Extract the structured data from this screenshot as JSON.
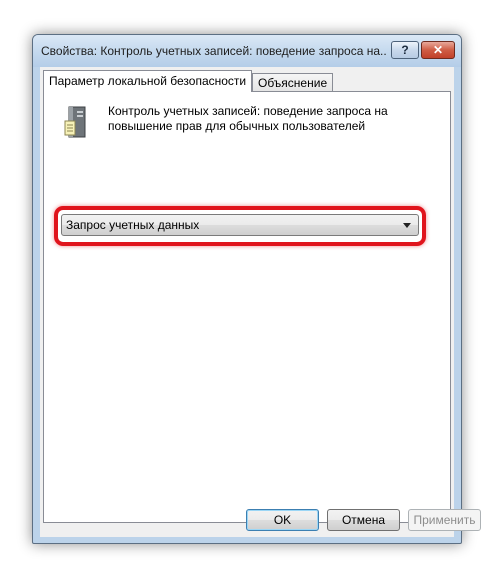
{
  "window": {
    "title": "Свойства: Контроль учетных записей: поведение запроса на...",
    "help_label": "?",
    "close_label": "✕"
  },
  "tabs": [
    {
      "label": "Параметр локальной безопасности",
      "active": true
    },
    {
      "label": "Объяснение",
      "active": false
    }
  ],
  "policy": {
    "icon": "server-icon",
    "description_line1": "Контроль учетных записей: поведение запроса на",
    "description_line2": "повышение прав для обычных пользователей"
  },
  "dropdown": {
    "selected": "Запрос учетных данных",
    "highlight_color": "#e0141c"
  },
  "buttons": {
    "ok": "OK",
    "cancel": "Отмена",
    "apply": "Применить"
  }
}
